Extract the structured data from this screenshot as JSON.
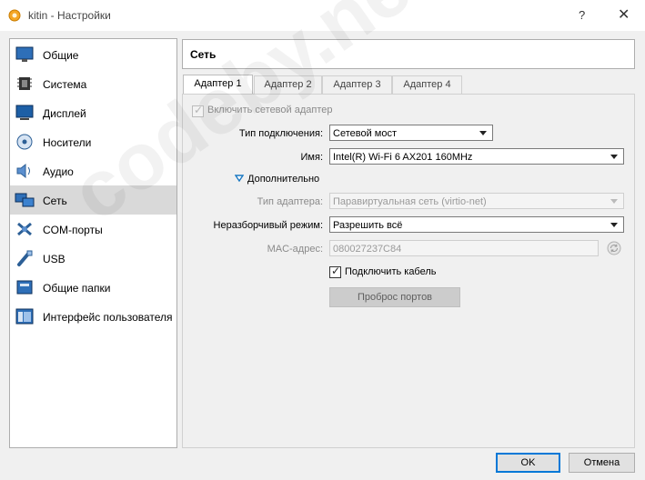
{
  "window": {
    "title": "kitin - Настройки",
    "help": "?",
    "close": "✕"
  },
  "sidebar": {
    "selected_index": 5,
    "items": [
      {
        "label": "Общие",
        "icon": "general-icon"
      },
      {
        "label": "Система",
        "icon": "system-icon"
      },
      {
        "label": "Дисплей",
        "icon": "display-icon"
      },
      {
        "label": "Носители",
        "icon": "storage-icon"
      },
      {
        "label": "Аудио",
        "icon": "audio-icon"
      },
      {
        "label": "Сеть",
        "icon": "network-icon"
      },
      {
        "label": "COM-порты",
        "icon": "serial-ports-icon"
      },
      {
        "label": "USB",
        "icon": "usb-icon"
      },
      {
        "label": "Общие папки",
        "icon": "shared-folders-icon"
      },
      {
        "label": "Интерфейс пользователя",
        "icon": "user-interface-icon"
      }
    ]
  },
  "header": {
    "title": "Сеть"
  },
  "tabs": [
    "Адаптер 1",
    "Адаптер 2",
    "Адаптер 3",
    "Адаптер 4"
  ],
  "adapter": {
    "enable_label": "Включить сетевой адаптер",
    "attached_label": "Тип подключения:",
    "attached_value": "Сетевой мост",
    "name_label": "Имя:",
    "name_value": "Intel(R) Wi-Fi 6 AX201 160MHz",
    "advanced_label": "Дополнительно",
    "adapter_type_label": "Тип адаптера:",
    "adapter_type_value": "Паравиртуальная сеть (virtio-net)",
    "promisc_label": "Неразборчивый режим:",
    "promisc_value": "Разрешить всё",
    "mac_label": "MAC-адрес:",
    "mac_value": "080027237C84",
    "cable_label": "Подключить кабель",
    "port_forward_label": "Проброс портов"
  },
  "footer": {
    "ok": "OK",
    "cancel": "Отмена"
  },
  "watermark": "codeby.net"
}
